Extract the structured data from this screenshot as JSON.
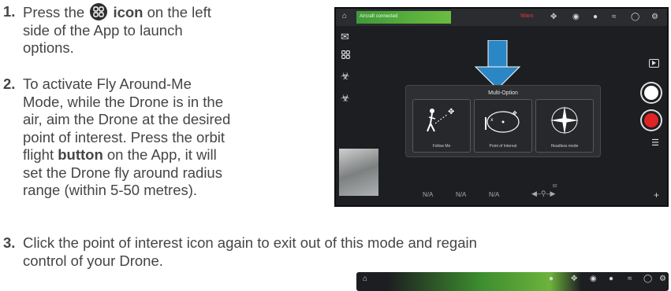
{
  "steps": [
    {
      "num": "1.",
      "pre": "Press the",
      "bold": "icon",
      "post": "on the left",
      "line2": "side of the App to launch",
      "line3": "options."
    },
    {
      "num": "2.",
      "lines": [
        "To activate Fly Around-Me",
        "Mode, while the Drone is in the",
        "air, aim the Drone at the desired",
        "point of interest. Press the orbit"
      ],
      "pre5": "flight",
      "bold5": "button",
      "post5": "on the App, it will",
      "line6": "set the Drone fly around radius",
      "line7": "range (within 5-50 metres)."
    },
    {
      "num": "3.",
      "line1": "Click the point of interest icon again to exit out of this mode and regain",
      "line2": "control of your Drone."
    }
  ],
  "app": {
    "status": "Aircraft connected",
    "warning": "Warn",
    "panel_title": "Multi-Option",
    "options": [
      "Follow Me",
      "Point of Interest",
      "Headless mode"
    ],
    "bottom_values": [
      "N/A",
      "N/A",
      "N/A"
    ],
    "altitude": "82",
    "icons": {
      "home": "home-icon",
      "mail": "mail-icon",
      "menu": "grid-menu-icon",
      "drone": "drone-icon",
      "camera": "camera-icon",
      "wifi": "wifi-icon",
      "eye": "vr-glasses-icon",
      "settings": "gear-icon",
      "play": "playback-icon",
      "shutter": "shutter-button",
      "record": "record-button"
    },
    "colors": {
      "accent_blue": "#2b86c5",
      "record_red": "#e02424",
      "status_green": "#57ad3c"
    }
  }
}
